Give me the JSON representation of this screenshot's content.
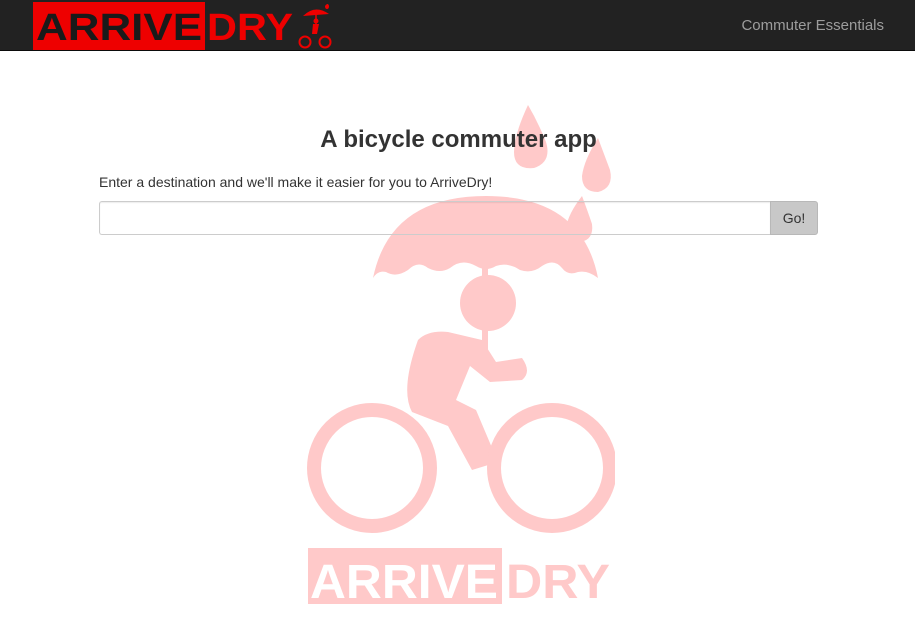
{
  "navbar": {
    "brand_part1": "ARRIVE",
    "brand_part2": "DRY",
    "link_label": "Commuter Essentials"
  },
  "main": {
    "title": "A bicycle commuter app",
    "prompt": "Enter a destination and we'll make it easier for you to ArriveDry!",
    "search_value": "",
    "go_label": "Go!"
  },
  "watermark": {
    "part1": "ARRIVE",
    "part2": "DRY"
  },
  "colors": {
    "brand_red": "#ee0000",
    "navbar_bg": "#222222",
    "watermark_pink": "#ffc9c9"
  }
}
